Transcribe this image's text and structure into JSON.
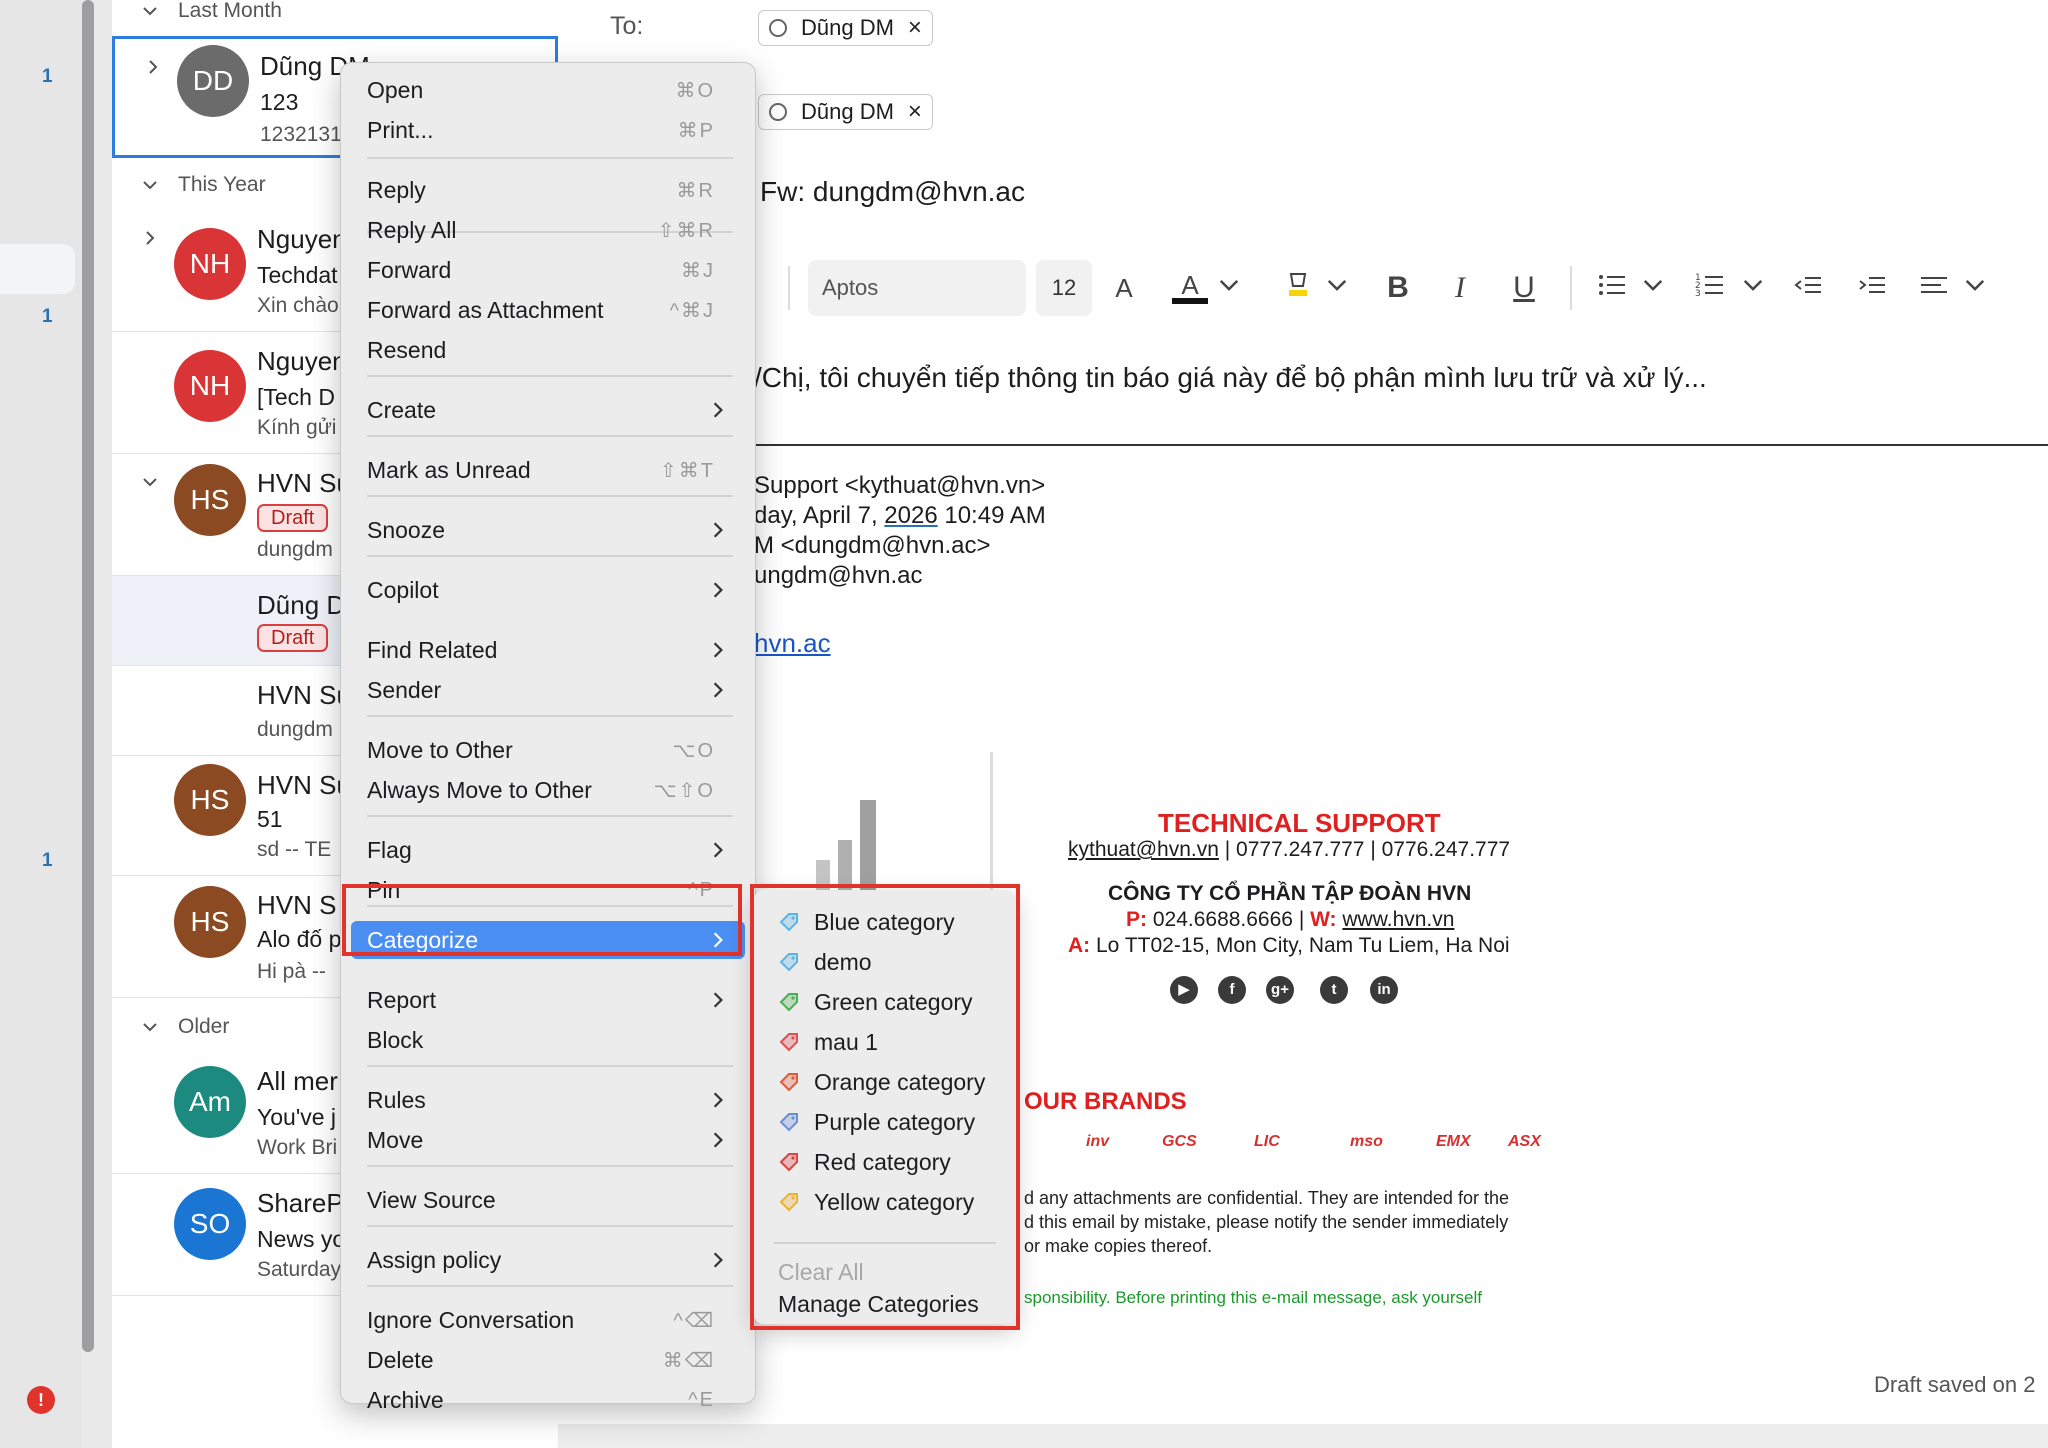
{
  "rail": {
    "counts": [
      "1",
      "1",
      "1"
    ],
    "error_badge": "!"
  },
  "message_list": {
    "groups": {
      "last_month": "Last Month",
      "this_year": "This Year",
      "older": "Older"
    },
    "messages": [
      {
        "initials": "DD",
        "sender": "Dũng DM",
        "subject": "123",
        "preview": "1232131",
        "color": "#6b6b6b"
      },
      {
        "initials": "NH",
        "sender": "Nguyen",
        "subject": "Techdat",
        "preview": "Xin chào",
        "color": "#d93436"
      },
      {
        "initials": "NH",
        "sender": "Nguyen",
        "subject": "[Tech D",
        "preview": "Kính gửi",
        "color": "#d93436"
      },
      {
        "initials": "HS",
        "sender": "HVN Su",
        "badge": "Draft",
        "preview": "dungdm",
        "color": "#8b4a22"
      },
      {
        "initials": "",
        "sender": "Dũng D",
        "badge": "Draft",
        "preview": "",
        "color": ""
      },
      {
        "initials": "",
        "sender": "HVN Su",
        "subject": "",
        "preview": "dungdm",
        "color": ""
      },
      {
        "initials": "HS",
        "sender": "HVN Su",
        "subject": "51",
        "preview": "sd -- TE",
        "color": "#8b4a22"
      },
      {
        "initials": "HS",
        "sender": "HVN S",
        "subject": "Alo đố p",
        "preview": "Hi pà --",
        "color": "#8b4a22"
      },
      {
        "initials": "Am",
        "sender": "All mer",
        "subject": "You've j",
        "preview": "Work Bri",
        "color": "#1d8a80"
      },
      {
        "initials": "SO",
        "sender": "ShareP",
        "subject": "News yo",
        "preview": "Saturday",
        "color": "#1a76d2"
      }
    ]
  },
  "compose": {
    "to_label": "To:",
    "to_chip": "Dũng DM",
    "cc_chip": "Dũng DM",
    "subject": "Fw: dungdm@hvn.ac",
    "toolbar": {
      "font": "Aptos",
      "size": "12"
    },
    "body_line": "/Chị, tôi chuyển tiếp thông tin báo giá này để bộ phận mình lưu trữ và xử lý...",
    "forward_header": {
      "from": "Support <kythuat@hvn.vn>",
      "sent_prefix": "day, April 7, ",
      "sent_year": "2026",
      "sent_suffix": " 10:49 AM",
      "to": "M <dungdm@hvn.ac>",
      "subject": "ungdm@hvn.ac",
      "link": "hvn.ac"
    },
    "signature": {
      "title": "TECHNICAL SUPPORT",
      "email": "kythuat@hvn.vn",
      "phones": " | 0777.247.777 | 0776.247.777",
      "company": "CÔNG TY CỔ PHẦN TẬP ĐOÀN HVN",
      "p_label": "P:",
      "phone": " 024.6688.6666",
      "w_label": "W:",
      "web": "www.hvn.vn",
      "a_label": "A:",
      "address": " Lo TT02-15, Mon City, Nam Tu Liem, Ha Noi",
      "social_icons": [
        "youtube-icon",
        "facebook-icon",
        "google-plus-icon",
        "twitter-icon",
        "linkedin-icon"
      ],
      "brands_title": "OUR BRANDS",
      "brands": [
        "inv",
        "GCS",
        "LIC",
        "mso",
        "EMX",
        "ASX"
      ]
    },
    "confidential": [
      "d any attachments are confidential. They are intended for the",
      "d this email by mistake, please notify the sender immediately",
      "or make copies thereof."
    ],
    "green_note": "sponsibility. Before printing this e-mail message, ask yourself",
    "draft_saved": "Draft saved on 2"
  },
  "context_menu": {
    "items": [
      {
        "label": "Open",
        "shortcut": "⌘O"
      },
      {
        "label": "Print...",
        "shortcut": "⌘P"
      },
      {
        "label": "Reply",
        "shortcut": "⌘R"
      },
      {
        "label": "Reply All",
        "shortcut": "⇧⌘R"
      },
      {
        "label": "Forward",
        "shortcut": "⌘J"
      },
      {
        "label": "Forward as Attachment",
        "shortcut": "^⌘J"
      },
      {
        "label": "Resend",
        "shortcut": ""
      },
      {
        "label": "Create",
        "submenu": true
      },
      {
        "label": "Mark as Unread",
        "shortcut": "⇧⌘T"
      },
      {
        "label": "Snooze",
        "submenu": true
      },
      {
        "label": "Copilot",
        "submenu": true
      },
      {
        "label": "Find Related",
        "submenu": true
      },
      {
        "label": "Sender",
        "submenu": true
      },
      {
        "label": "Move to Other",
        "shortcut": "⌥O"
      },
      {
        "label": "Always Move to Other",
        "shortcut": "⌥⇧O"
      },
      {
        "label": "Flag",
        "submenu": true
      },
      {
        "label": "Pin",
        "shortcut": "^P"
      },
      {
        "label": "Categorize",
        "submenu": true,
        "active": true
      },
      {
        "label": "Report",
        "submenu": true
      },
      {
        "label": "Block",
        "shortcut": ""
      },
      {
        "label": "Rules",
        "submenu": true
      },
      {
        "label": "Move",
        "submenu": true
      },
      {
        "label": "View Source",
        "shortcut": ""
      },
      {
        "label": "Assign policy",
        "submenu": true
      },
      {
        "label": "Ignore Conversation",
        "shortcut": "^⌫"
      },
      {
        "label": "Delete",
        "shortcut": "⌘⌫"
      },
      {
        "label": "Archive",
        "shortcut": "^E"
      }
    ]
  },
  "categorize_submenu": {
    "items": [
      {
        "label": "Blue category",
        "color": "#5ab4e6"
      },
      {
        "label": "demo",
        "color": "#5ab4e6"
      },
      {
        "label": "Green category",
        "color": "#4caf50"
      },
      {
        "label": "mau 1",
        "color": "#e05050"
      },
      {
        "label": "Orange category",
        "color": "#e05a3a"
      },
      {
        "label": "Purple category",
        "color": "#6a8fd8"
      },
      {
        "label": "Red category",
        "color": "#e04040"
      },
      {
        "label": "Yellow category",
        "color": "#f0b030"
      }
    ],
    "clear_all": "Clear All",
    "manage": "Manage Categories"
  },
  "colors": {
    "accent": "#4a8ef2",
    "annotation": "#e0332c"
  }
}
